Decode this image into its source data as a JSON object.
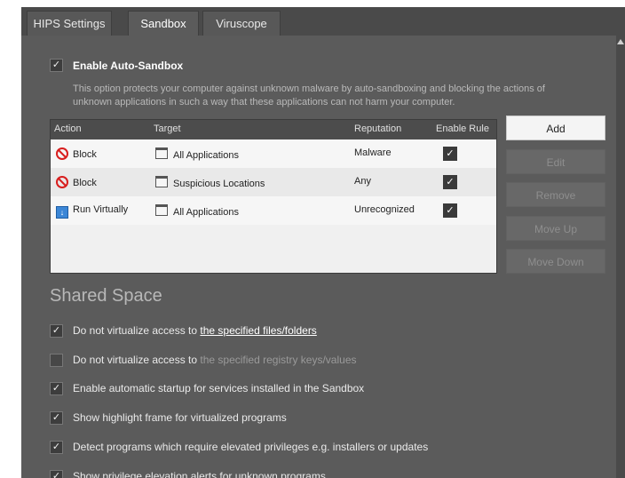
{
  "tabs": [
    {
      "label": "HIPS Settings"
    },
    {
      "label": "Sandbox"
    },
    {
      "label": "Viruscope"
    }
  ],
  "auto_sandbox": {
    "label": "Enable Auto-Sandbox",
    "checked": true,
    "description_line1": "This option protects your computer against unknown malware by auto-sandboxing and blocking the actions of",
    "description_line2": "unknown applications in such a way that these applications can not harm your computer."
  },
  "rules_table": {
    "headers": [
      "Action",
      "Target",
      "Reputation",
      "Enable Rule"
    ],
    "rows": [
      {
        "action": "Block",
        "action_icon": "block-icon",
        "target": "All Applications",
        "target_icon": "folder-icon",
        "reputation": "Malware",
        "enabled": true
      },
      {
        "action": "Block",
        "action_icon": "block-icon",
        "target": "Suspicious Locations",
        "target_icon": "folder-icon",
        "reputation": "Any",
        "enabled": true
      },
      {
        "action": "Run Virtually",
        "action_icon": "run-virtually-icon",
        "target": "All Applications",
        "target_icon": "folder-icon",
        "reputation": "Unrecognized",
        "enabled": true
      }
    ]
  },
  "buttons": {
    "add": "Add",
    "edit": "Edit",
    "remove": "Remove",
    "move_up": "Move Up",
    "move_down": "Move Down"
  },
  "shared_space": {
    "heading": "Shared Space",
    "options": [
      {
        "prefix": "Do not virtualize access to",
        "link": "the specified files/folders",
        "checked": true,
        "link_enabled": true
      },
      {
        "prefix": "Do not virtualize access to",
        "link": "the specified registry keys/values",
        "checked": false,
        "link_enabled": false
      },
      {
        "label": "Enable automatic startup for services installed in the Sandbox",
        "checked": true
      },
      {
        "label": "Show highlight frame for virtualized programs",
        "checked": true
      },
      {
        "label": "Detect programs which require elevated privileges e.g. installers or updates",
        "checked": true
      },
      {
        "label": "Show privilege elevation alerts for unknown programs",
        "checked": true
      }
    ]
  },
  "colors": {
    "background": "#5b5b5b",
    "table_background": "#f0f0f0",
    "block_icon": "#d81e1e",
    "run_virtually_icon": "#3b86d6"
  }
}
